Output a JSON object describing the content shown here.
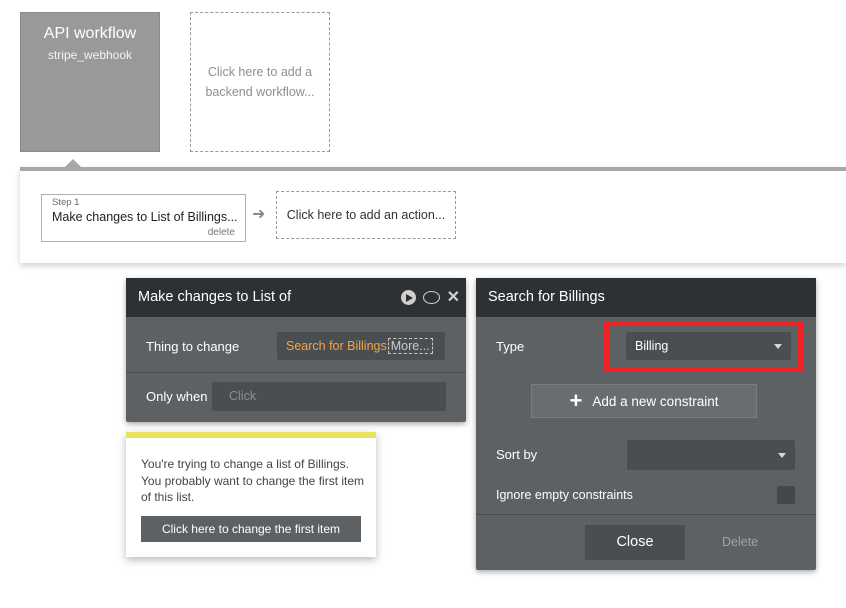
{
  "workflow_card": {
    "title": "API workflow",
    "subtitle": "stripe_webhook"
  },
  "add_backend_workflow": "Click here to add a backend workflow...",
  "step": {
    "label": "Step 1",
    "name": "Make changes to List of Billings...",
    "delete": "delete"
  },
  "add_action": "Click here to add an action...",
  "action_panel": {
    "title": "Make changes to List of",
    "icons": [
      "play-icon",
      "comment-icon",
      "close-icon"
    ],
    "thing_label": "Thing to change",
    "thing_value": "Search for Billings",
    "thing_more": "More...",
    "only_when_label": "Only when",
    "only_when_placeholder": "Click"
  },
  "tip": {
    "message": "You're trying to change a list of Billings. You probably want to change the first item of this list.",
    "button": "Click here to change the first item",
    "accent_color": "#e9e25f"
  },
  "search_panel": {
    "title": "Search for Billings",
    "type_label": "Type",
    "type_value": "Billing",
    "add_constraint": "Add a new constraint",
    "sort_label": "Sort by",
    "sort_value": "",
    "ignore_label": "Ignore empty constraints",
    "ignore_checked": false,
    "close": "Close",
    "delete": "Delete",
    "highlight_color": "#ee2222"
  }
}
